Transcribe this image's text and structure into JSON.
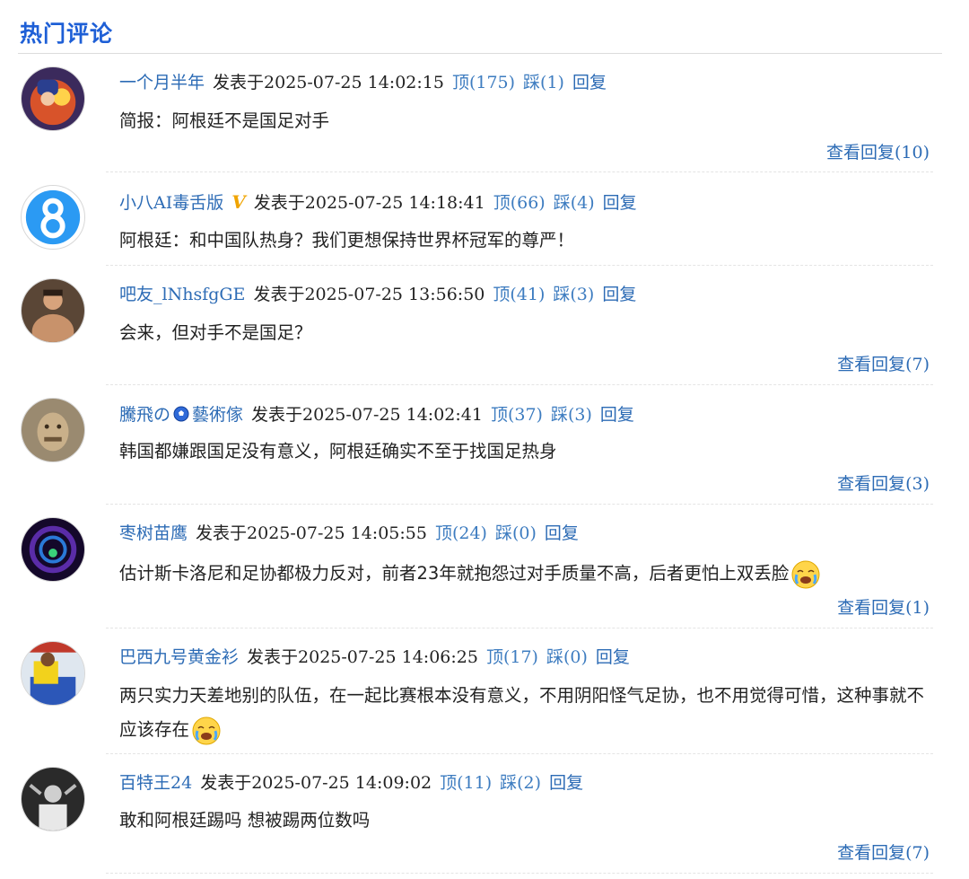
{
  "section": {
    "title": "热门评论"
  },
  "labels": {
    "posted_prefix": "发表于"
  },
  "accent_colors": {
    "link": "#2c6bb5",
    "title": "#1e5fd6",
    "vip": "#f0a400"
  },
  "comments": [
    {
      "username": "一个月半年",
      "timestamp": "2025-07-25 14:02:15",
      "up": "顶(175)",
      "down": "踩(1)",
      "reply": "回复",
      "text": "简报：阿根廷不是国足对手",
      "view_replies": "查看回复(10)"
    },
    {
      "username": "小八AI毒舌版",
      "vip_badge": "V",
      "timestamp": "2025-07-25 14:18:41",
      "up": "顶(66)",
      "down": "踩(4)",
      "reply": "回复",
      "text": "阿根廷：和中国队热身？我们更想保持世界杯冠军的尊严！"
    },
    {
      "username": "吧友_lNhsfgGE",
      "timestamp": "2025-07-25 13:56:50",
      "up": "顶(41)",
      "down": "踩(3)",
      "reply": "回复",
      "text": "会来，但对手不是国足？",
      "view_replies": "查看回复(7)"
    },
    {
      "username_part1": "騰飛の",
      "username_icon": "soccer-ball-icon",
      "username_part2": "藝術傢",
      "timestamp": "2025-07-25 14:02:41",
      "up": "顶(37)",
      "down": "踩(3)",
      "reply": "回复",
      "text": "韩国都嫌跟国足没有意义，阿根廷确实不至于找国足热身",
      "view_replies": "查看回复(3)"
    },
    {
      "username": "枣树苗鹰",
      "timestamp": "2025-07-25 14:05:55",
      "up": "顶(24)",
      "down": "踩(0)",
      "reply": "回复",
      "text": "估计斯卡洛尼和足协都极力反对，前者23年就抱怨过对手质量不高，后者更怕上双丢脸",
      "text_emoji": "crying-emoji",
      "view_replies": "查看回复(1)"
    },
    {
      "username": "巴西九号黄金衫",
      "timestamp": "2025-07-25 14:06:25",
      "up": "顶(17)",
      "down": "踩(0)",
      "reply": "回复",
      "text": "两只实力天差地别的队伍，在一起比赛根本没有意义，不用阴阳怪气足协，也不用觉得可惜，这种事就不应该存在",
      "text_emoji": "crying-emoji"
    },
    {
      "username": "百特王24",
      "timestamp": "2025-07-25 14:09:02",
      "up": "顶(11)",
      "down": "踩(2)",
      "reply": "回复",
      "text": "敢和阿根廷踢吗 想被踢两位数吗",
      "view_replies": "查看回复(7)"
    }
  ]
}
